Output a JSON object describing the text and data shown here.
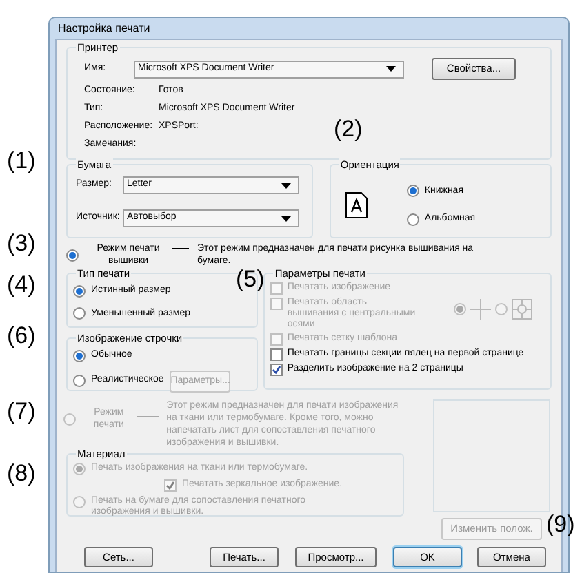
{
  "window": {
    "title": "Настройка печати"
  },
  "printer": {
    "label": "Принтер",
    "name_label": "Имя:",
    "name_value": "Microsoft XPS Document Writer",
    "properties_button": "Свойства...",
    "info": [
      {
        "label": "Состояние:",
        "value": "Готов"
      },
      {
        "label": "Тип:",
        "value": "Microsoft XPS Document Writer"
      },
      {
        "label": "Расположение:",
        "value": "XPSPort:"
      },
      {
        "label": "Замечания:"
      }
    ]
  },
  "paper": {
    "label": "Бумага",
    "fields": [
      {
        "label": "Размер:",
        "value": "Letter"
      },
      {
        "label": "Источник:",
        "value": "Автовыбор"
      }
    ]
  },
  "orientation": {
    "label": "Ориентация",
    "options": [
      {
        "label": "Книжная",
        "selected": true
      },
      {
        "label": "Альбомная",
        "selected": false
      }
    ]
  },
  "embroidery_mode": {
    "label": "Режим печати вышивки",
    "selected": true,
    "description": "Этот режим предназначен для печати рисунка вышивания на бумаге."
  },
  "print_type": {
    "label": "Тип печати",
    "options": [
      {
        "label": "Истинный размер",
        "selected": true
      },
      {
        "label": "Уменьшенный размер",
        "selected": false
      }
    ]
  },
  "line_image": {
    "label": "Изображение строчки",
    "options": [
      {
        "label": "Обычное",
        "selected": true
      },
      {
        "label": "Реалистическое",
        "selected": false
      }
    ],
    "params_button": "Параметры...",
    "params_disabled": true
  },
  "print_params": {
    "label": "Параметры печати",
    "options": [
      {
        "kind": "checkbox",
        "label": "Печатать изображение",
        "checked": false,
        "disabled": true
      },
      {
        "kind": "axes",
        "label": "Печатать область вышивания с центральными осями",
        "checked": false,
        "disabled": true,
        "choices": [
          {
            "selected": true
          },
          {
            "selected": false
          }
        ]
      },
      {
        "kind": "checkbox",
        "label": "Печатать сетку шаблона",
        "checked": false,
        "disabled": true
      },
      {
        "kind": "checkbox",
        "label": "Печатать границы секции пялец на первой странице",
        "checked": false,
        "disabled": false
      },
      {
        "kind": "checkbox",
        "label": "Разделить изображение на 2 страницы",
        "checked": true,
        "disabled": false
      }
    ]
  },
  "print_mode": {
    "label": "Режим печати",
    "selected": false,
    "disabled": true,
    "description": "Этот режим предназначен для печати изображения на ткани или термобумаге. Кроме того, можно напечатать лист для сопоставления печатного изображения и вышивки."
  },
  "material": {
    "label": "Материал",
    "options": [
      {
        "kind": "radio",
        "label": "Печать изображения на ткани или термобумаге.",
        "selected": true,
        "disabled": true
      },
      {
        "kind": "checkbox",
        "label": "Печатать зеркальное изображение.",
        "checked": true,
        "disabled": true
      },
      {
        "kind": "radio",
        "label": "Печать на бумаге для сопоставления печатного изображения и вышивки.",
        "selected": false,
        "disabled": true
      }
    ]
  },
  "change_position_button": {
    "label": "Изменить полож.",
    "disabled": true
  },
  "buttons": [
    {
      "label": "Сеть...",
      "default": false
    },
    {
      "label": "Печать...",
      "default": false
    },
    {
      "label": "Просмотр...",
      "default": false
    },
    {
      "label": "OK",
      "default": true
    },
    {
      "label": "Отмена",
      "default": false
    }
  ],
  "callouts": [
    "(1)",
    "(2)",
    "(3)",
    "(4)",
    "(5)",
    "(6)",
    "(7)",
    "(8)",
    "(9)"
  ]
}
